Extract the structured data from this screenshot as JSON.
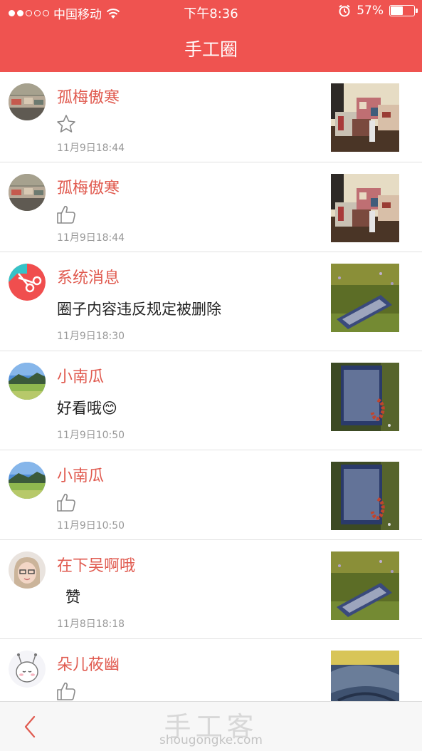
{
  "status_bar": {
    "carrier": "中国移动",
    "time": "下午8:36",
    "battery_text": "57%",
    "battery_level": 0.57,
    "signal_icon": "signal-dots-icon",
    "wifi_icon": "wifi-icon",
    "alarm_icon": "alarm-icon"
  },
  "header": {
    "title": "手工圈",
    "color": "#ef5350"
  },
  "notifications": [
    {
      "user": "孤梅傲寒",
      "icon": "star-outline-icon",
      "time": "11月9日18:44"
    },
    {
      "user": "孤梅傲寒",
      "icon": "thumbs-up-icon",
      "time": "11月9日18:44"
    },
    {
      "user": "系统消息",
      "message": "圈子内容违反规定被删除",
      "time": "11月9日18:30",
      "avatar_icon": "scissors-icon"
    },
    {
      "user": "小南瓜",
      "message": "好看哦😊",
      "time": "11月9日10:50"
    },
    {
      "user": "小南瓜",
      "icon": "thumbs-up-icon",
      "time": "11月9日10:50"
    },
    {
      "user": "在下吴啊哦",
      "message": "赞",
      "time": "11月8日18:18"
    },
    {
      "user": "朵儿莜幽",
      "icon": "thumbs-up-icon"
    }
  ],
  "bottom_bar": {
    "back_icon": "chevron-left-icon",
    "watermark_cn": "手工客",
    "watermark_en": "shougongke.com"
  }
}
